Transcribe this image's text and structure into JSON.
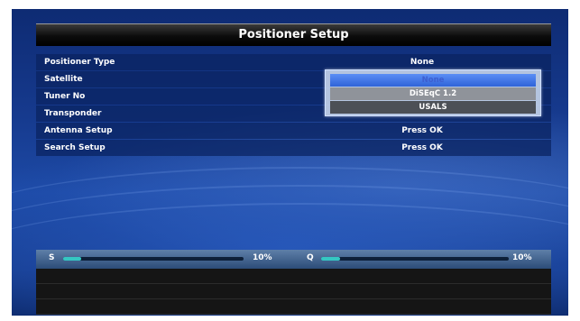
{
  "title": "Positioner Setup",
  "menu": [
    {
      "label": "Positioner Type",
      "value": "None"
    },
    {
      "label": "Satellite",
      "value": ""
    },
    {
      "label": "Tuner No",
      "value": ""
    },
    {
      "label": "Transponder",
      "value": ""
    },
    {
      "label": "Antenna Setup",
      "value": "Press OK"
    },
    {
      "label": "Search Setup",
      "value": "Press OK"
    }
  ],
  "dropdown": {
    "options": [
      "None",
      "DiSEqC 1.2",
      "USALS"
    ],
    "selected": "None"
  },
  "signal": {
    "strength": {
      "label": "S",
      "percent_text": "10%",
      "level": 0.1
    },
    "quality": {
      "label": "Q",
      "percent_text": "10%",
      "level": 0.1
    }
  },
  "colors": {
    "accent": "#2f63d8",
    "meter_fill": "#35c7c2"
  }
}
